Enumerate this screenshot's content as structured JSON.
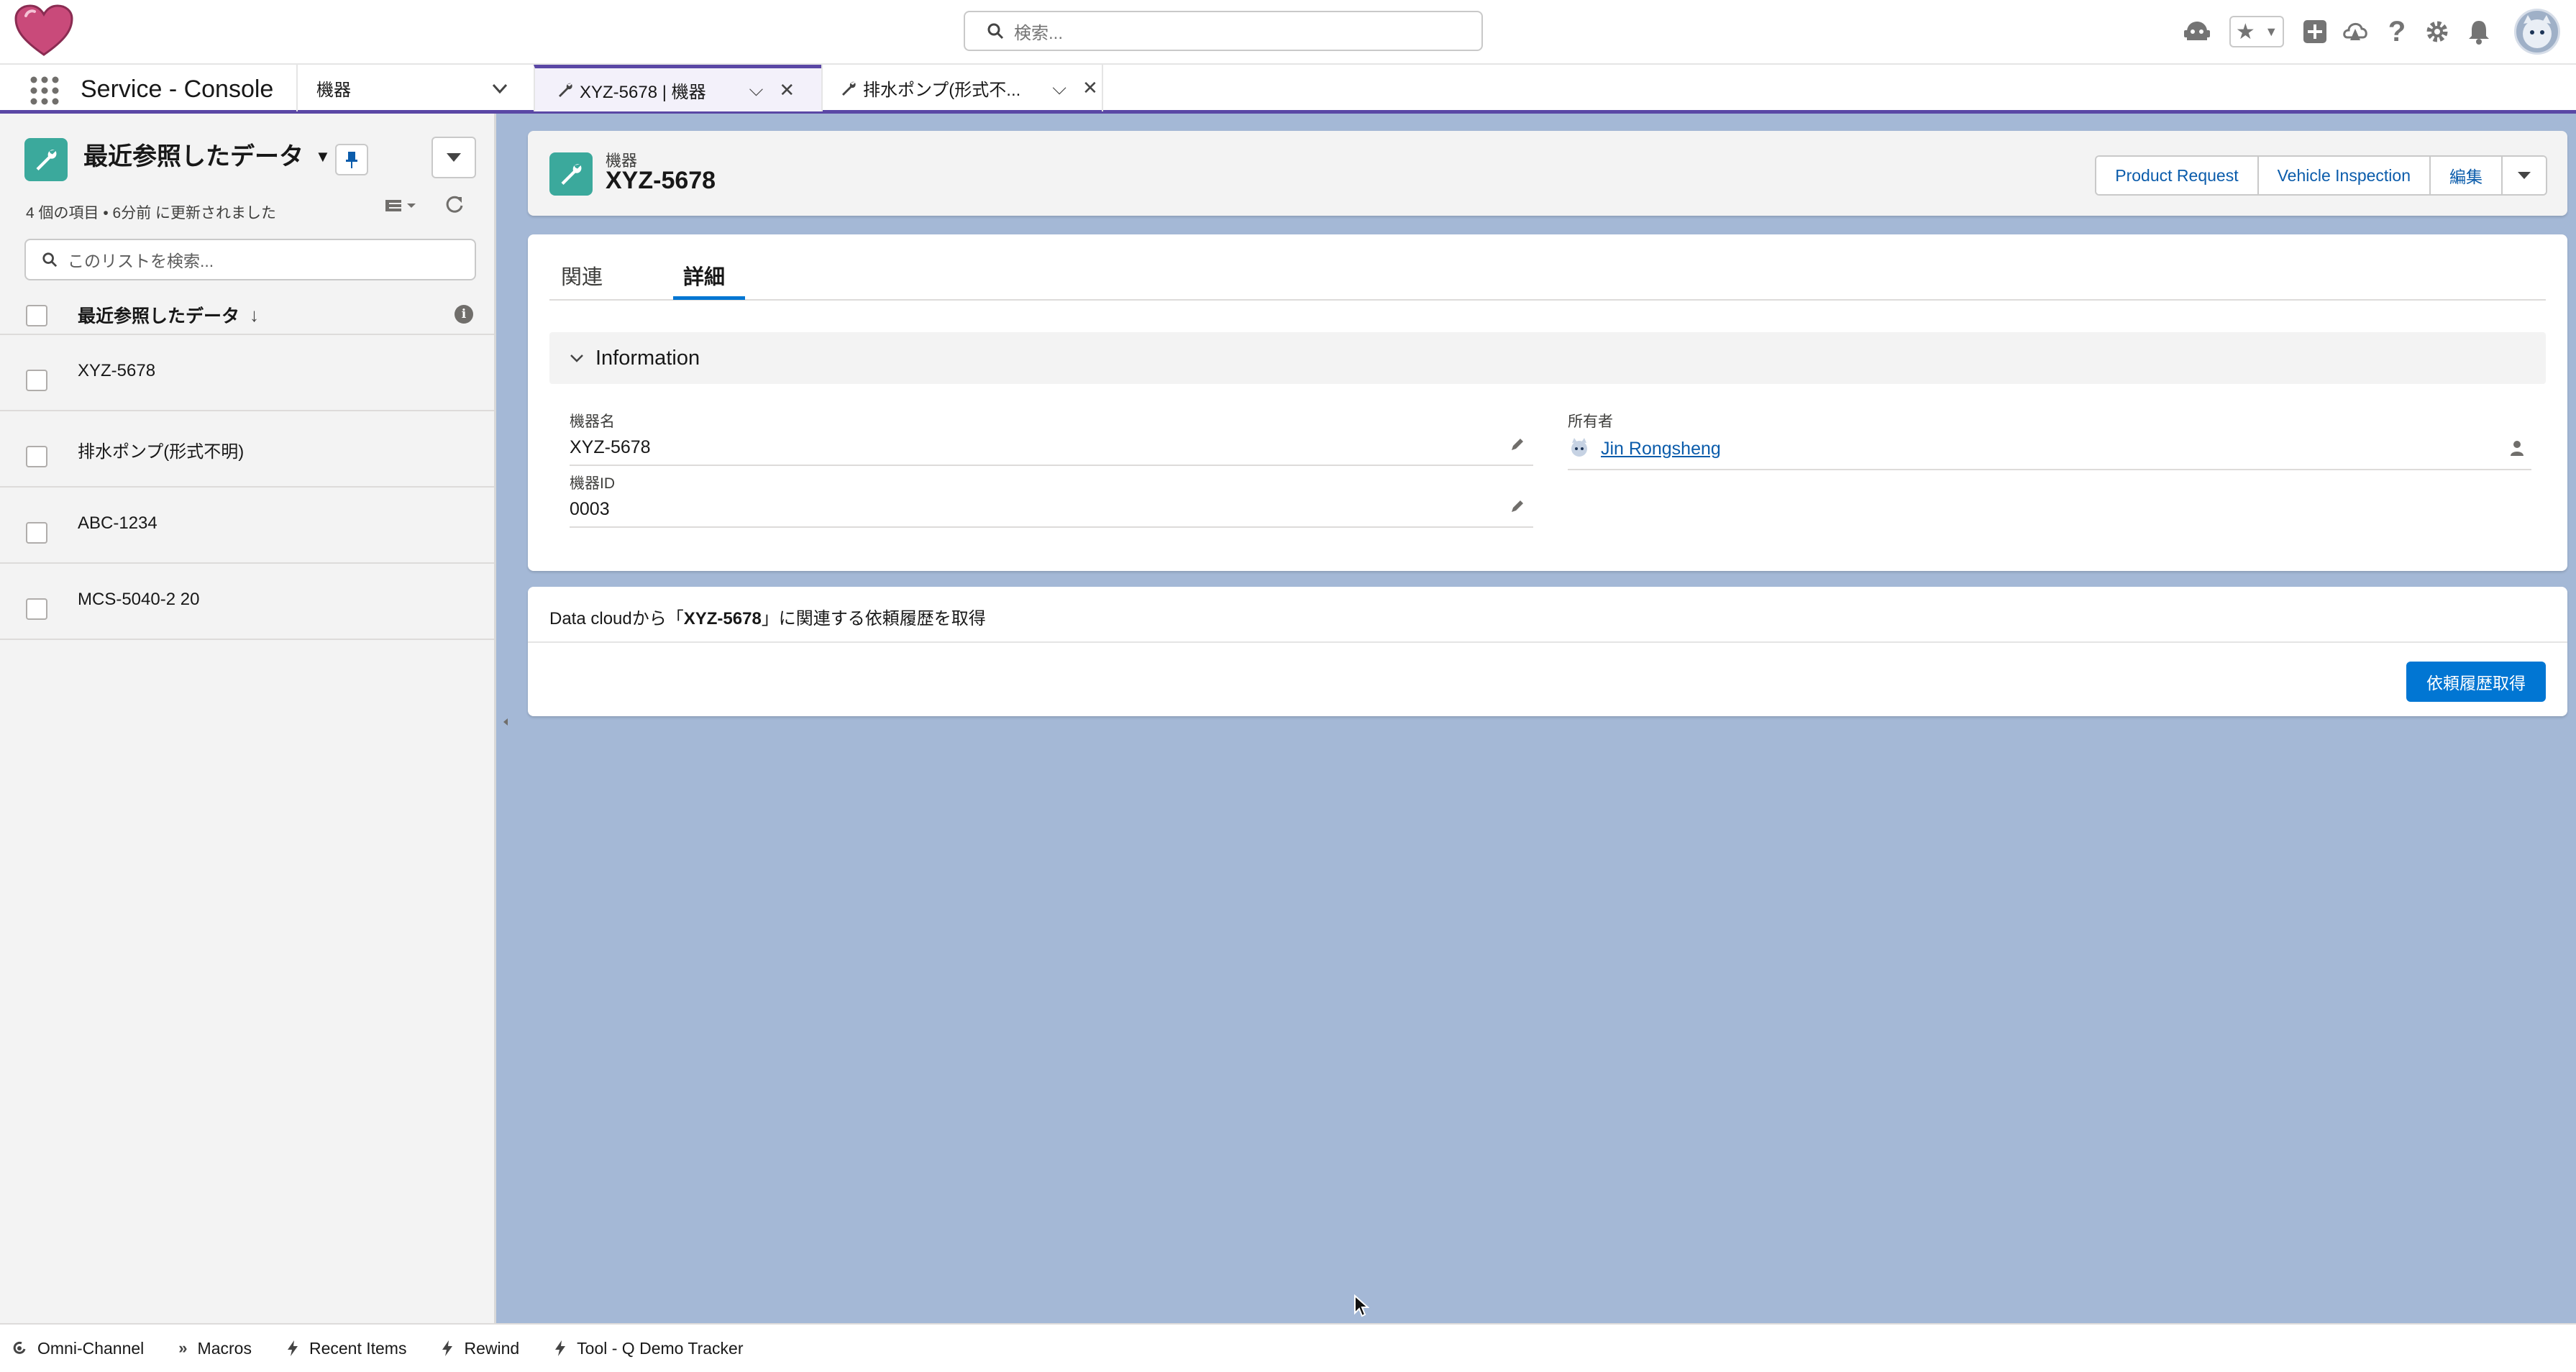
{
  "header": {
    "search_placeholder": "検索..."
  },
  "nav": {
    "app_name": "Service - Console",
    "object_selector": "機器",
    "tabs": [
      {
        "label": "XYZ-5678 | 機器",
        "active": true
      },
      {
        "label": "排水ポンプ(形式不...",
        "active": false
      }
    ]
  },
  "list_view": {
    "title": "最近参照したデータ",
    "meta": "4 個の項目 • 6分前 に更新されました",
    "search_placeholder": "このリストを検索...",
    "column_header": "最近参照したデータ",
    "rows": [
      {
        "label": "XYZ-5678"
      },
      {
        "label": "排水ポンプ(形式不明)"
      },
      {
        "label": "ABC-1234"
      },
      {
        "label": "MCS-5040-2 20"
      }
    ]
  },
  "record": {
    "object_type": "機器",
    "name": "XYZ-5678",
    "actions": [
      "Product Request",
      "Vehicle Inspection",
      "編集"
    ],
    "tabs": [
      "関連",
      "詳細"
    ],
    "active_tab": "詳細",
    "section_title": "Information",
    "fields": {
      "equipment_name_label": "機器名",
      "equipment_name_value": "XYZ-5678",
      "equipment_id_label": "機器ID",
      "equipment_id_value": "0003",
      "owner_label": "所有者",
      "owner_value": "Jin Rongsheng"
    }
  },
  "data_cloud": {
    "text_prefix": "Data cloudから「",
    "text_record": "XYZ-5678",
    "text_suffix": "」に関連する依頼履歴を取得",
    "button_label": "依頼履歴取得"
  },
  "utility_bar": {
    "items": [
      {
        "label": "Omni-Channel",
        "icon": "omni-channel-icon"
      },
      {
        "label": "Macros",
        "icon": "macros-icon"
      },
      {
        "label": "Recent Items",
        "icon": "lightning-icon"
      },
      {
        "label": "Rewind",
        "icon": "lightning-icon"
      },
      {
        "label": "Tool - Q Demo Tracker",
        "icon": "lightning-icon"
      }
    ]
  },
  "colors": {
    "brand_purple": "#5a47a5",
    "object_icon_teal": "#3ba99c",
    "primary_blue": "#0176d3",
    "link_blue": "#0b5cab",
    "workspace_background": "#a4b8d6"
  }
}
